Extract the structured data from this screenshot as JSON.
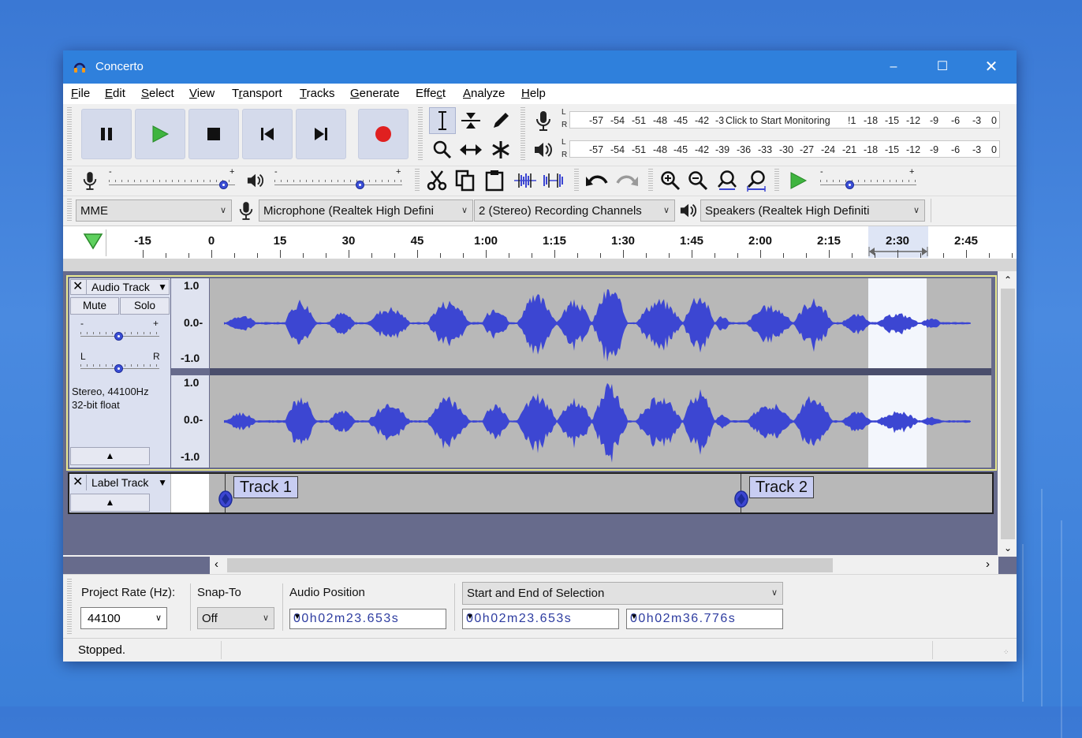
{
  "window": {
    "title": "Concerto"
  },
  "menu": [
    {
      "pre": "",
      "u": "F",
      "post": "ile"
    },
    {
      "pre": "",
      "u": "E",
      "post": "dit"
    },
    {
      "pre": "",
      "u": "S",
      "post": "elect"
    },
    {
      "pre": "",
      "u": "V",
      "post": "iew"
    },
    {
      "pre": "T",
      "u": "r",
      "post": "ansport"
    },
    {
      "pre": "",
      "u": "T",
      "post": "racks"
    },
    {
      "pre": "",
      "u": "G",
      "post": "enerate"
    },
    {
      "pre": "Effe",
      "u": "c",
      "post": "t"
    },
    {
      "pre": "",
      "u": "A",
      "post": "nalyze"
    },
    {
      "pre": "",
      "u": "H",
      "post": "elp"
    }
  ],
  "meters": {
    "rec_ticks": [
      "-57",
      "-54",
      "-51",
      "-48",
      "-45",
      "-42",
      "-3"
    ],
    "rec_ticks_right": [
      "!1",
      "-18",
      "-15",
      "-12",
      "-9",
      "-6",
      "-3",
      "0"
    ],
    "monitor_label": "Click to Start Monitoring",
    "play_ticks": [
      "-57",
      "-54",
      "-51",
      "-48",
      "-45",
      "-42",
      "-39",
      "-36",
      "-33",
      "-30",
      "-27",
      "-24",
      "-21",
      "-18",
      "-15",
      "-12",
      "-9",
      "-6",
      "-3",
      "0"
    ],
    "left": "L",
    "right": "R"
  },
  "mixer": {
    "minus": "-",
    "plus": "+"
  },
  "devices": {
    "host": "MME",
    "input": "Microphone (Realtek High Defini",
    "channels": "2 (Stereo) Recording Channels",
    "output": "Speakers (Realtek High Definiti"
  },
  "ruler": [
    "-15",
    "0",
    "15",
    "30",
    "45",
    "1:00",
    "1:15",
    "1:30",
    "1:45",
    "2:00",
    "2:15",
    "2:30",
    "2:45"
  ],
  "audio_track": {
    "name": "Audio Track",
    "mute": "Mute",
    "solo": "Solo",
    "gain_minus": "-",
    "gain_plus": "+",
    "pan_left": "L",
    "pan_right": "R",
    "info1": "Stereo, 44100Hz",
    "info2": "32-bit float",
    "scale_top": "1.0",
    "scale_mid": "0.0-",
    "scale_bot": "-1.0"
  },
  "label_track": {
    "name": "Label Track",
    "labels": [
      "Track 1",
      "Track 2"
    ]
  },
  "selection_bar": {
    "project_rate_label": "Project Rate (Hz):",
    "project_rate": "44100",
    "snap_label": "Snap-To",
    "snap_value": "Off",
    "audio_position_label": "Audio Position",
    "selection_mode": "Start and End of Selection",
    "audio_position": "00h02m23.653s",
    "sel_start": "00h02m23.653s",
    "sel_end": "00h02m36.776s"
  },
  "status": {
    "text": "Stopped."
  },
  "colors": {
    "accent": "#2f80dc",
    "wave": "#3c46d2",
    "play": "#3fb43f",
    "record": "#e02020"
  }
}
